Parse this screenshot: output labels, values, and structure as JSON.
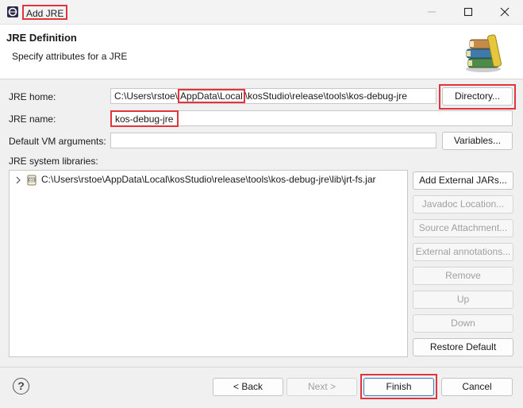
{
  "window": {
    "title": "Add JRE"
  },
  "header": {
    "title": "JRE Definition",
    "subtitle": "Specify attributes for a JRE"
  },
  "form": {
    "jre_home_label": "JRE home:",
    "jre_home_value": {
      "prefix": "C:\\Users\\rstoe\\",
      "highlight": "AppData\\Local",
      "suffix": "\\kosStudio\\release\\tools\\kos-debug-jre"
    },
    "directory_button": "Directory...",
    "jre_name_label": "JRE name:",
    "jre_name_value": "kos-debug-jre",
    "vm_args_label": "Default VM arguments:",
    "vm_args_value": "",
    "variables_button": "Variables...",
    "libraries_label": "JRE system libraries:"
  },
  "libraries": [
    {
      "path": "C:\\Users\\rstoe\\AppData\\Local\\kosStudio\\release\\tools\\kos-debug-jre\\lib\\jrt-fs.jar"
    }
  ],
  "side_buttons": [
    {
      "label": "Add External JARs...",
      "enabled": true
    },
    {
      "label": "Javadoc Location...",
      "enabled": false
    },
    {
      "label": "Source Attachment...",
      "enabled": false
    },
    {
      "label": "External annotations...",
      "enabled": false
    },
    {
      "label": "Remove",
      "enabled": false
    },
    {
      "label": "Up",
      "enabled": false
    },
    {
      "label": "Down",
      "enabled": false
    },
    {
      "label": "Restore Default",
      "enabled": true
    }
  ],
  "footer": {
    "help": "?",
    "back": "< Back",
    "next": "Next >",
    "finish": "Finish",
    "cancel": "Cancel"
  },
  "colors": {
    "highlight_box": "#e3343b",
    "disabled_text": "#a0a0a0"
  }
}
